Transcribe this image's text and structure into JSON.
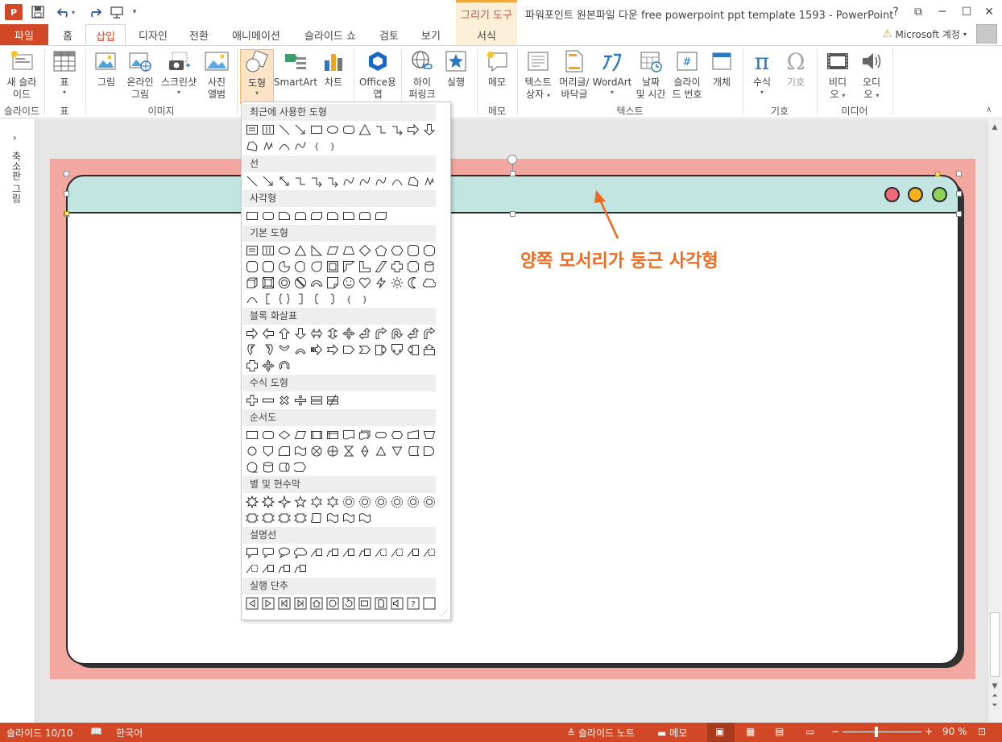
{
  "app": {
    "logo": "P",
    "window_title": "파워포인트 원본파일 다운 free powerpoint ppt template 1593 - PowerPoint",
    "contextual_group": "그리기 도구",
    "contextual_tab": "서식",
    "account_label": "Microsoft 계정",
    "help": "?",
    "restore": "⧉",
    "minimize": "─",
    "maximize": "☐",
    "close": "✕"
  },
  "tabs": [
    "파일",
    "홈",
    "삽입",
    "디자인",
    "전환",
    "애니메이션",
    "슬라이드 쇼",
    "검토",
    "보기"
  ],
  "ribbon": {
    "new_slide": [
      "새 슬라",
      "이드"
    ],
    "table": "표",
    "picture": "그림",
    "online_picture": [
      "온라인",
      "그림"
    ],
    "screenshot": "스크린샷",
    "photo_album": [
      "사진",
      "앨범"
    ],
    "shapes": "도형",
    "smartart": "SmartArt",
    "chart": "차트",
    "office_apps": [
      "Office용",
      "앱"
    ],
    "hyperlink": [
      "하이",
      "퍼링크"
    ],
    "action": "실행",
    "comment": "메모",
    "textbox": [
      "텍스트",
      "상자"
    ],
    "header_footer": [
      "머리글/",
      "바닥글"
    ],
    "wordart": "WordArt",
    "date_time": [
      "날짜",
      "및 시간"
    ],
    "slide_number": [
      "슬라이",
      "드 번호"
    ],
    "object": "개체",
    "equation": "수식",
    "symbol": "기호",
    "video": [
      "비디",
      "오"
    ],
    "audio": [
      "오디",
      "오"
    ],
    "groups": {
      "slides": "슬라이드",
      "tables": "표",
      "images": "이미지",
      "comments": "메모",
      "text": "텍스트",
      "symbols": "기호",
      "media": "미디어"
    }
  },
  "thumbnails_label": "축소판 그림",
  "gallery": {
    "sections": [
      "최근에 사용한 도형",
      "선",
      "사각형",
      "기본 도형",
      "블록 화살표",
      "수식 도형",
      "순서도",
      "별 및 현수막",
      "설명선",
      "실행 단추"
    ]
  },
  "slide": {
    "callout": "양쪽 모서리가 둥근 사각형",
    "background_color": "#f2a7a0",
    "header_color": "#c2e5e1",
    "dot_colors": [
      "#f06a7a",
      "#f5b21b",
      "#8ed256"
    ],
    "arrow_color": "#f06a1e"
  },
  "status": {
    "slide_info": "슬라이드 10/10",
    "language": "한국어",
    "notes": "슬라이드 노트",
    "comments": "메모",
    "zoom": "90 %",
    "zoom_minus": "−",
    "zoom_plus": "+"
  }
}
